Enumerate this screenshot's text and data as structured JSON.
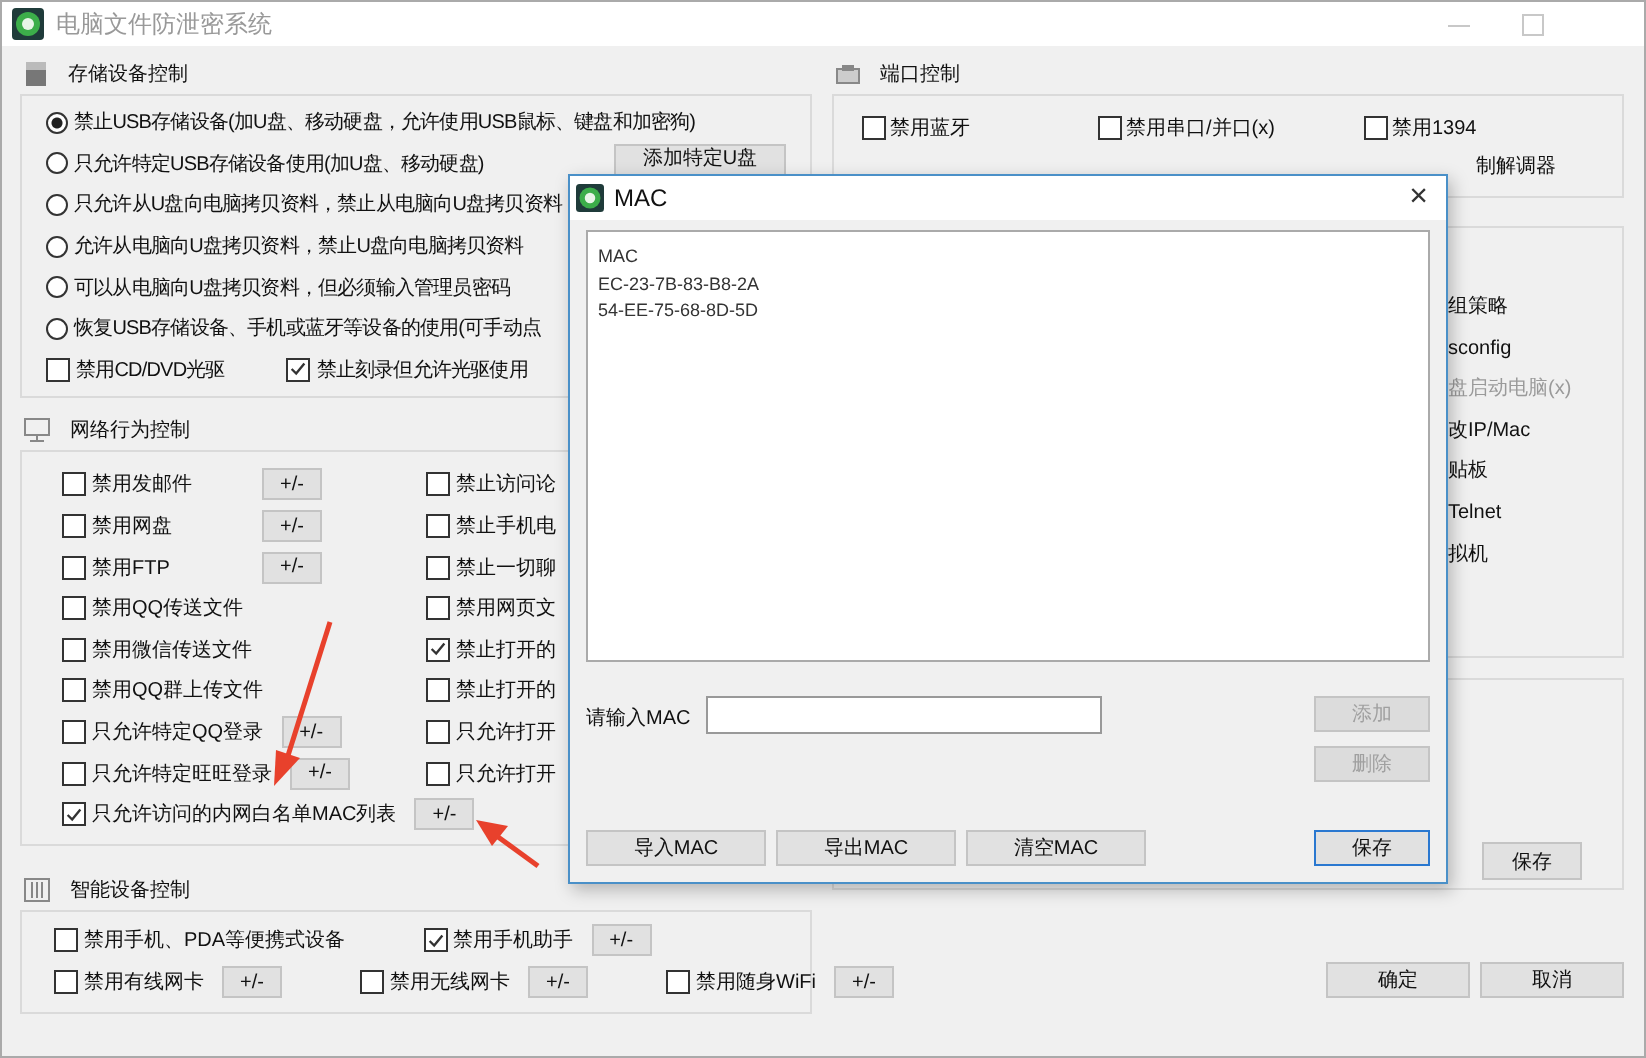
{
  "window": {
    "title": "电脑文件防泄密系统"
  },
  "storage": {
    "title": "存储设备控制",
    "options": [
      {
        "label": "禁止USB存储设备(加U盘、移动硬盘，允许使用USB鼠标、键盘和加密狗)",
        "selected": true
      },
      {
        "label": "只允许特定USB存储设备使用(加U盘、移动硬盘)",
        "selected": false,
        "button": "添加特定U盘"
      },
      {
        "label": "只允许从U盘向电脑拷贝资料，禁止从电脑向U盘拷贝资料",
        "selected": false
      },
      {
        "label": "允许从电脑向U盘拷贝资料，禁止U盘向电脑拷贝资料",
        "selected": false
      },
      {
        "label": "可以从电脑向U盘拷贝资料，但必须输入管理员密码",
        "selected": false
      },
      {
        "label": "恢复USB存储设备、手机或蓝牙等设备的使用(可手动点",
        "selected": false
      }
    ],
    "checks": [
      {
        "label": "禁用CD/DVD光驱",
        "checked": false
      },
      {
        "label": "禁止刻录但允许光驱使用",
        "checked": true
      }
    ]
  },
  "network": {
    "title": "网络行为控制",
    "left": [
      {
        "label": "禁用发邮件",
        "checked": false,
        "button": "+/-"
      },
      {
        "label": "禁用网盘",
        "checked": false,
        "button": "+/-"
      },
      {
        "label": "禁用FTP",
        "checked": false,
        "button": "+/-"
      },
      {
        "label": "禁用QQ传送文件",
        "checked": false
      },
      {
        "label": "禁用微信传送文件",
        "checked": false
      },
      {
        "label": "禁用QQ群上传文件",
        "checked": false
      },
      {
        "label": "只允许特定QQ登录",
        "checked": false,
        "button": "+/-"
      },
      {
        "label": "只允许特定旺旺登录",
        "checked": false,
        "button": "+/-"
      },
      {
        "label": "只允许访问的内网白名单MAC列表",
        "checked": true,
        "button": "+/-"
      }
    ],
    "right": [
      {
        "label": "禁止访问论",
        "checked": false
      },
      {
        "label": "禁止手机电",
        "checked": false
      },
      {
        "label": "禁止一切聊",
        "checked": false
      },
      {
        "label": "禁用网页文",
        "checked": false
      },
      {
        "label": "禁止打开的",
        "checked": true
      },
      {
        "label": "禁止打开的",
        "checked": false
      },
      {
        "label": "只允许打开",
        "checked": false
      },
      {
        "label": "只允许打开",
        "checked": false
      }
    ]
  },
  "smart": {
    "title": "智能设备控制",
    "rows": [
      [
        {
          "label": "禁用手机、PDA等便携式设备",
          "checked": false
        },
        {
          "label": "禁用手机助手",
          "checked": true,
          "button": "+/-"
        }
      ],
      [
        {
          "label": "禁用有线网卡",
          "checked": false,
          "button": "+/-"
        },
        {
          "label": "禁用无线网卡",
          "checked": false,
          "button": "+/-"
        },
        {
          "label": "禁用随身WiFi",
          "checked": false,
          "button": "+/-"
        }
      ]
    ]
  },
  "ports": {
    "title": "端口控制",
    "items": [
      {
        "label": "禁用蓝牙",
        "checked": false
      },
      {
        "label": "禁用串口/并口(x)",
        "checked": false
      },
      {
        "label": "禁用1394",
        "checked": false
      }
    ],
    "partial_label": "制解调器"
  },
  "system": {
    "items": [
      {
        "label": "组策略",
        "disabled": false
      },
      {
        "label": "sconfig",
        "disabled": false
      },
      {
        "label": "盘启动电脑(x)",
        "disabled": true
      },
      {
        "label": "改IP/Mac",
        "disabled": false
      },
      {
        "label": "贴板",
        "disabled": false
      },
      {
        "label": "Telnet",
        "disabled": false
      },
      {
        "label": "拟机",
        "disabled": false
      }
    ]
  },
  "save_button": "保存",
  "buttons": [
    "确定",
    "取消"
  ],
  "dialog": {
    "title": "MAC",
    "close": "×",
    "list_header": "MAC",
    "rows": [
      "EC-23-7B-83-B8-2A",
      "54-EE-75-68-8D-5D"
    ],
    "input_label": "请输入MAC",
    "side_buttons": [
      {
        "label": "添加",
        "disabled": true
      },
      {
        "label": "删除",
        "disabled": true
      }
    ],
    "bottom_buttons": [
      "导入MAC",
      "导出MAC",
      "清空MAC"
    ],
    "save_button": "保存"
  }
}
